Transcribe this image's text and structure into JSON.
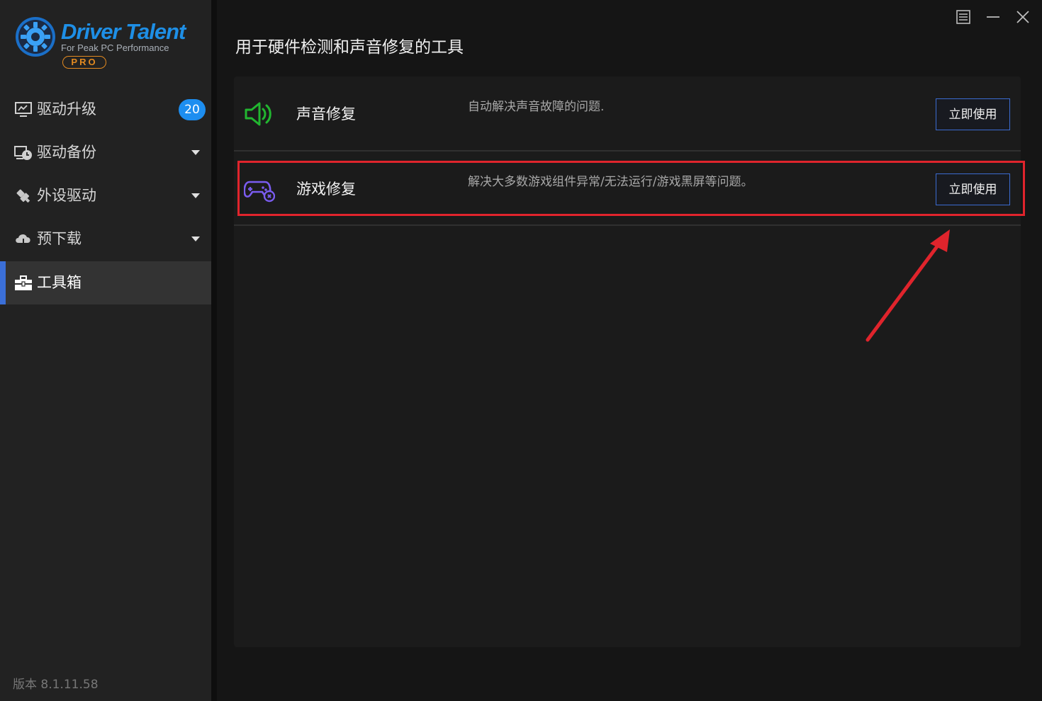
{
  "app": {
    "logo_title": "Driver Talent",
    "logo_subtitle": "For Peak PC Performance",
    "logo_edition": "PRO"
  },
  "sidebar": {
    "items": [
      {
        "label": "驱动升级",
        "icon": "monitor-icon",
        "badge": "20"
      },
      {
        "label": "驱动备份",
        "icon": "backup-clock-icon"
      },
      {
        "label": "外设驱动",
        "icon": "usb-plug-icon"
      },
      {
        "label": "预下载",
        "icon": "cloud-download-icon"
      },
      {
        "label": "工具箱",
        "icon": "toolbox-icon",
        "active": true
      }
    ],
    "version": "版本 8.1.11.58"
  },
  "window_controls": [
    "menu-icon",
    "minimize-icon",
    "close-icon"
  ],
  "main": {
    "title": "用于硬件检测和声音修复的工具",
    "tools": [
      {
        "name": "声音修复",
        "description": "自动解决声音故障的问题.",
        "button": "立即使用",
        "icon": "speaker-icon"
      },
      {
        "name": "游戏修复",
        "description": "解决大多数游戏组件异常/无法运行/游戏黑屏等问题。",
        "button": "立即使用",
        "icon": "gamepad-icon"
      }
    ]
  },
  "colors": {
    "accent_blue": "#1d8ef0",
    "active_indicator": "#3b6fd8",
    "speaker_green": "#22b630",
    "gamepad_purple": "#7a5cf0",
    "annotation_red": "#e0242c",
    "logo_orange": "#e38a20"
  }
}
